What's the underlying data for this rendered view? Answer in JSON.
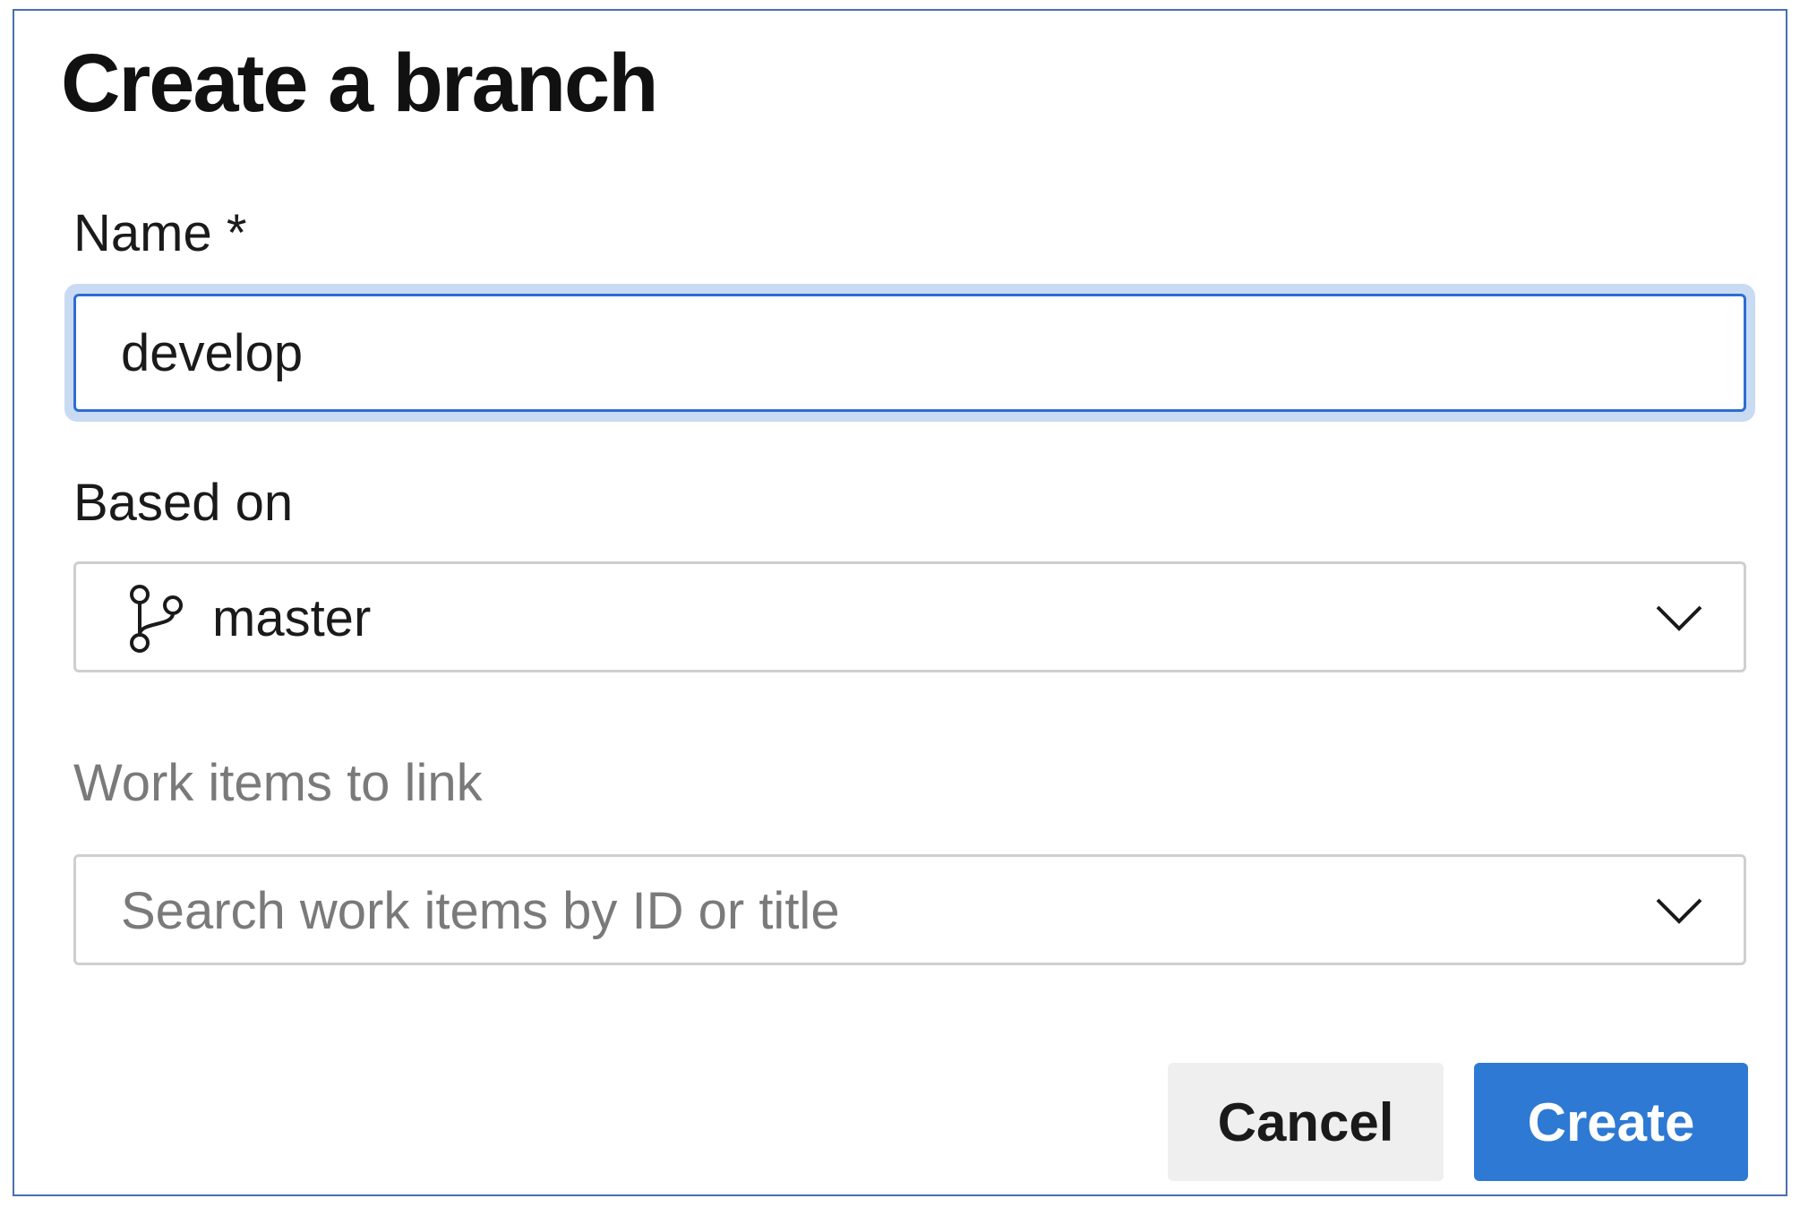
{
  "dialog": {
    "title": "Create a branch"
  },
  "name_field": {
    "label": "Name *",
    "value": "develop"
  },
  "based_on": {
    "label": "Based on",
    "selected": "master",
    "icon": "branch-icon"
  },
  "work_items": {
    "label": "Work items to link",
    "placeholder": "Search work items by ID or title",
    "icon": "chevron-down-icon"
  },
  "actions": {
    "cancel_label": "Cancel",
    "create_label": "Create"
  },
  "colors": {
    "primary": "#2e79d3",
    "focus_border": "#2f6cd4",
    "focus_ring": "#c9dbf3",
    "dialog_border": "#4a6fb3"
  }
}
